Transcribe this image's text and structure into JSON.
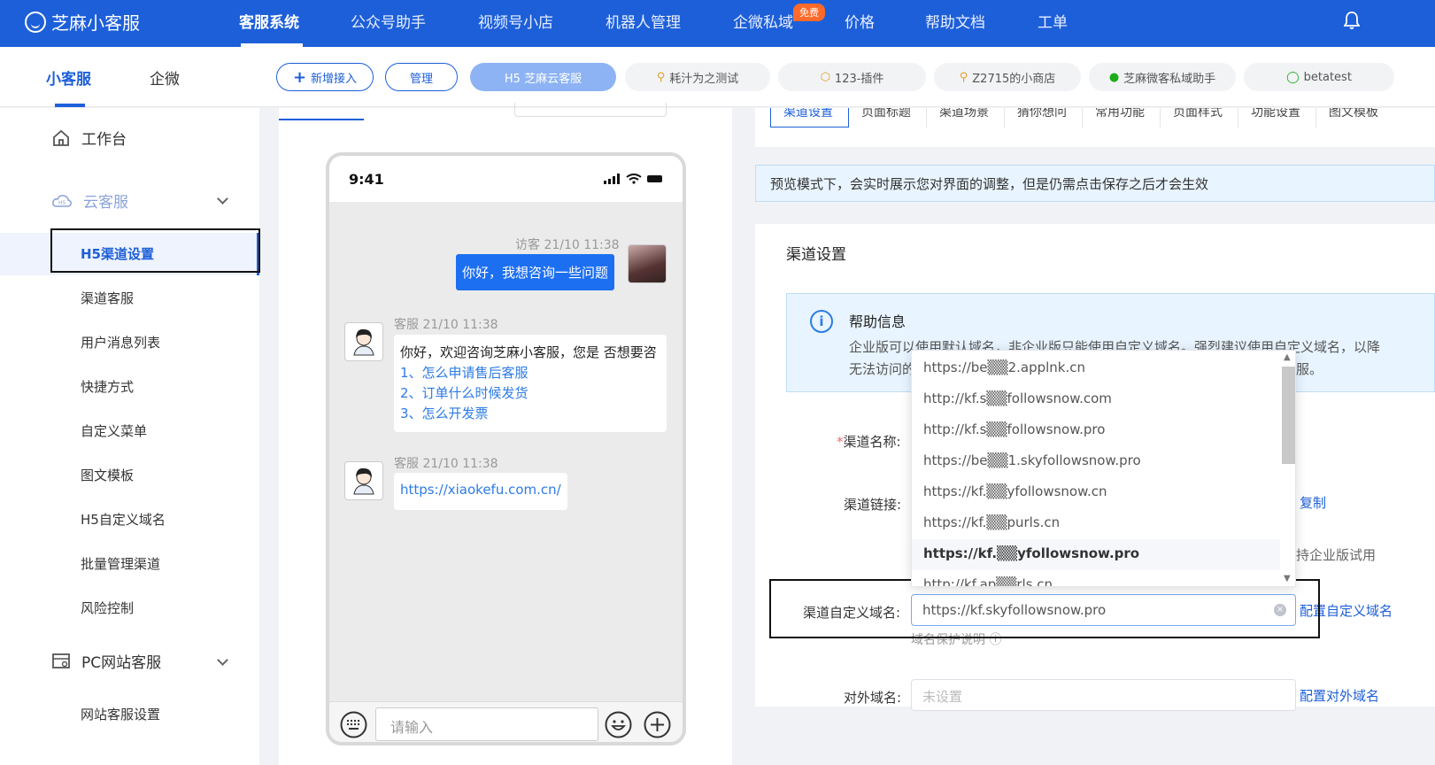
{
  "brand": {
    "name": "芝麻小客服"
  },
  "nav": {
    "items": [
      "客服系统",
      "公众号助手",
      "视频号小店",
      "机器人管理",
      "企微私域",
      "价格",
      "帮助文档",
      "工单"
    ],
    "free_badge": "免费"
  },
  "subnav": {
    "tabs": [
      "小客服",
      "企微"
    ]
  },
  "channels": {
    "add": "新增接入",
    "manage": "管理",
    "chips": [
      "H5 芝麻云客服",
      "耗汁为之测试",
      "123-插件",
      "Z2715的小商店",
      "芝麻微客私域助手",
      "betatest"
    ]
  },
  "sidebar": {
    "workbench": "工作台",
    "cloud": "云客服",
    "cloud_items": [
      "H5渠道设置",
      "渠道客服",
      "用户消息列表",
      "快捷方式",
      "自定义菜单",
      "图文模板",
      "H5自定义域名",
      "批量管理渠道",
      "风险控制"
    ],
    "pc": "PC网站客服",
    "pc_items": [
      "网站客服设置"
    ]
  },
  "phone": {
    "time": "9:41",
    "visitor_meta": "访客 21/10 11:38",
    "visitor_msg": "你好，我想咨询一些问题",
    "agent_meta1": "客服 21/10 11:38",
    "agent_msg1": "你好，欢迎咨询芝麻小客服，您是 否想要咨",
    "agent_links": [
      "1、怎么申请售后客服",
      "2、订单什么时候发货",
      "3、怎么开发票"
    ],
    "agent_meta2": "客服 21/10 11:38",
    "agent_msg2": "https://xiaokefu.com.cn/",
    "input_placeholder": "请输入"
  },
  "panel_tabs": [
    "渠道设置",
    "页面标题",
    "渠道场景",
    "猜你想问",
    "常用功能",
    "页面样式",
    "功能设置",
    "图文模板"
  ],
  "notice": "预览模式下，会实时展示您对界面的调整，但是仍需点击保存之后才会生效",
  "settings": {
    "title": "渠道设置",
    "help_title": "帮助信息",
    "help_line1": "企业版可以使用默认域名，非企业版只能使用自定义域名。强烈建议使用自定义域名，以降",
    "help_line2": "无法访问的",
    "help_line2_tail": "服。",
    "channel_name_label": "渠道名称:",
    "channel_link_label": "渠道链接:",
    "copy": "复制",
    "trial_tip": "持企业版试用",
    "custom_domain_label": "渠道自定义域名:",
    "custom_domain_value": "https://kf.skyfollowsnow.pro",
    "config_custom": "配置自定义域名",
    "domain_protect": "域名保护说明",
    "external_label": "对外域名:",
    "external_placeholder": "未设置",
    "config_external": "配置对外域名"
  },
  "domain_options": [
    "https://be▒▒2.applnk.cn",
    "http://kf.s▒▒followsnow.com",
    "http://kf.s▒▒followsnow.pro",
    "https://be▒▒1.skyfollowsnow.pro",
    "https://kf.▒▒yfollowsnow.cn",
    "https://kf.▒▒purls.cn",
    "https://kf.▒▒yfollowsnow.pro",
    "http://kf.ap▒▒rls.cn"
  ],
  "colors": {
    "brand": "#1d5fd9",
    "badge": "#ff6a2b",
    "bubble": "#1d6ff2"
  }
}
